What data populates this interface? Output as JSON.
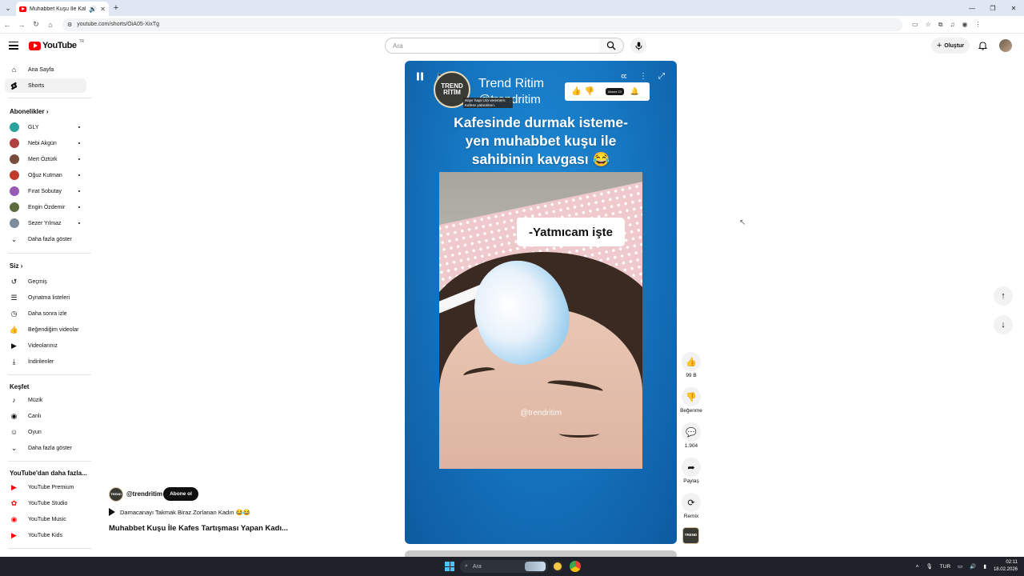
{
  "browser": {
    "tab_title": "Muhabbet Kuşu İle Kafes Ta",
    "url": "youtube.com/shorts/OiA05-XixTg",
    "new_tab_label": "+"
  },
  "header": {
    "logo_text": "YouTube",
    "logo_country": "TR",
    "search_placeholder": "Ara",
    "create_label": "Oluştur"
  },
  "sidebar": {
    "main": [
      {
        "label": "Ana Sayfa",
        "icon": "home-icon"
      },
      {
        "label": "Shorts",
        "icon": "shorts-icon"
      }
    ],
    "subscriptions_title": "Abonelikler",
    "subscriptions": [
      {
        "label": "GLY",
        "color": "#2aa3a0"
      },
      {
        "label": "Nebi Akgün",
        "color": "#b0413e"
      },
      {
        "label": "Mert Öztürk",
        "color": "#7a4a3a"
      },
      {
        "label": "Oğuz Kutman",
        "color": "#c0392b"
      },
      {
        "label": "Fırat Sobutay",
        "color": "#9b59b6"
      },
      {
        "label": "Engin Özdemir",
        "color": "#5d6d3e"
      },
      {
        "label": "Sezer Yılmaz",
        "color": "#7f8c9d"
      }
    ],
    "show_more": "Daha fazla göster",
    "you_title": "Siz",
    "you_items": [
      {
        "label": "Geçmiş",
        "icon": "history-icon"
      },
      {
        "label": "Oynatma listeleri",
        "icon": "playlist-icon"
      },
      {
        "label": "Daha sonra izle",
        "icon": "clock-icon"
      },
      {
        "label": "Beğendiğim videolar",
        "icon": "like-icon"
      },
      {
        "label": "Videolarınız",
        "icon": "video-icon"
      },
      {
        "label": "İndirilenler",
        "icon": "download-icon"
      }
    ],
    "explore_title": "Keşfet",
    "explore_items": [
      {
        "label": "Müzik",
        "icon": "music-icon"
      },
      {
        "label": "Canlı",
        "icon": "live-icon"
      },
      {
        "label": "Oyun",
        "icon": "gaming-icon"
      }
    ],
    "explore_more": "Daha fazla göster",
    "more_title": "YouTube'dan daha fazla...",
    "more_items": [
      {
        "label": "YouTube Premium"
      },
      {
        "label": "YouTube Studio"
      },
      {
        "label": "YouTube Music"
      },
      {
        "label": "YouTube Kids"
      }
    ]
  },
  "short": {
    "brand_logo_line1": "TREND",
    "brand_logo_line2": "RİTİM",
    "brand_name": "Trend Ritim",
    "brand_handle": "@trendritim",
    "tooltip": "Hayır hayır izin veremem. Kafese yatacaksın.",
    "subscribe_pill": "Abone Ol",
    "headline_line1": "Kafesinde durmak isteme-",
    "headline_line2": "yen muhabbet kuşu ile",
    "headline_line3": "sahibinin kavgası 😂",
    "caption": "-Yatmıcam işte",
    "watermark": "@trendritim"
  },
  "info": {
    "channel_handle": "@trendritim",
    "subscribe_label": "Abone ol",
    "sound_text": "Damacanayı Takmak Biraz Zorlanan Kadın 😂😂",
    "video_title": "Muhabbet Kuşu İle Kafes Tartışması Yapan Kadı..."
  },
  "actions": {
    "like_count": "99 B",
    "dislike_label": "Beğenme",
    "comment_count": "1.904",
    "share_label": "Paylaş",
    "remix_label": "Remix"
  },
  "taskbar": {
    "search_placeholder": "Ara",
    "lang": "TUR",
    "time": "02:11",
    "date": "18.02.2026"
  }
}
